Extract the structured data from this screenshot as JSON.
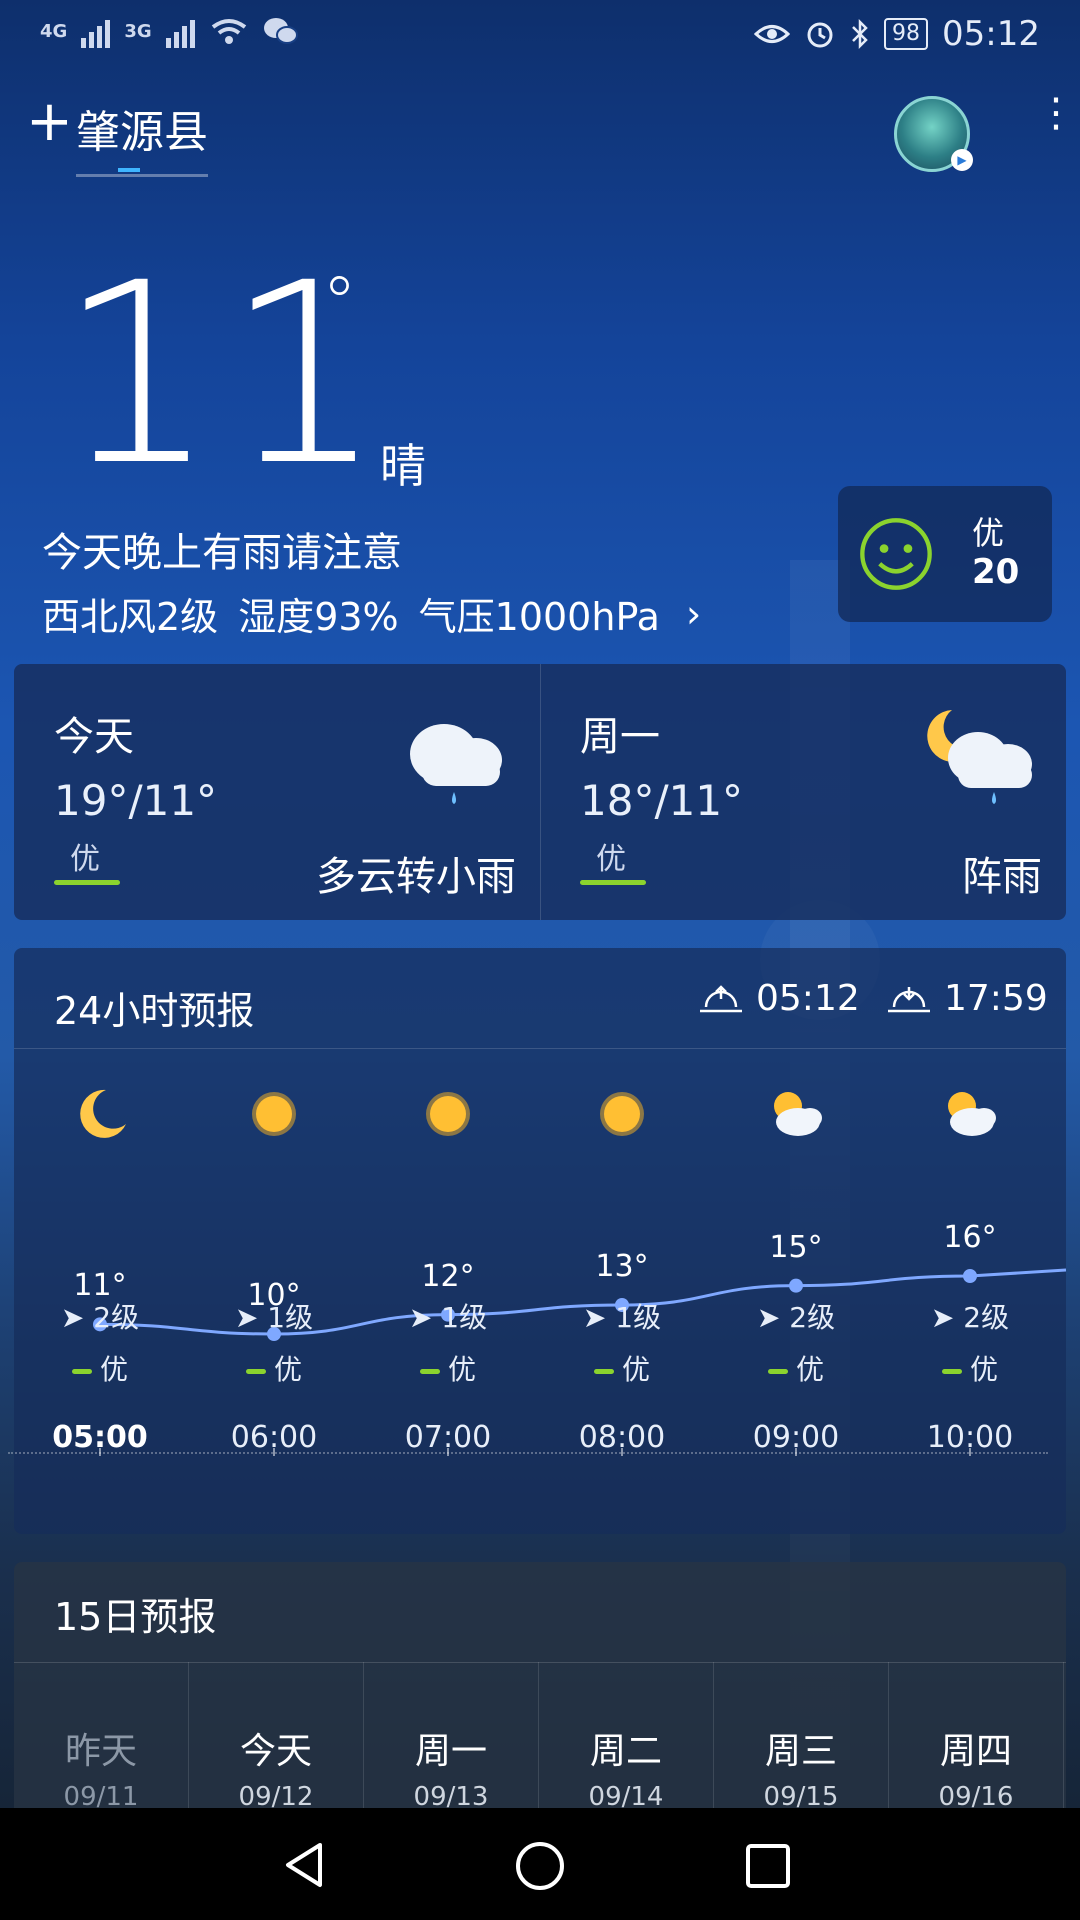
{
  "status_bar": {
    "net1": "4G",
    "net2": "3G",
    "battery": "98",
    "time": "05:12"
  },
  "header": {
    "add_icon": "plus-icon",
    "city": "肇源县",
    "more_icon": "more-vert-icon"
  },
  "current": {
    "temperature": "11",
    "degree": "°",
    "condition": "晴",
    "alert": "今天晚上有雨请注意",
    "wind": "西北风2级",
    "humidity": "湿度93%",
    "pressure": "气压1000hPa",
    "chevron": "›"
  },
  "aqi": {
    "label": "优",
    "value": "20",
    "color": "#8bd32e"
  },
  "days": [
    {
      "name": "今天",
      "temps": "19°/11°",
      "aqi": "优",
      "condition": "多云转小雨",
      "icon": "cloud-rain-icon"
    },
    {
      "name": "周一",
      "temps": "18°/11°",
      "aqi": "优",
      "condition": "阵雨",
      "icon": "moon-cloud-rain-icon"
    }
  ],
  "hourly": {
    "title": "24小时预报",
    "sunrise": "05:12",
    "sunset": "17:59",
    "hours": [
      {
        "time": "05:00",
        "temp": "11°",
        "value": 11,
        "wind": "2级",
        "aqi": "优",
        "icon": "moon"
      },
      {
        "time": "06:00",
        "temp": "10°",
        "value": 10,
        "wind": "1级",
        "aqi": "优",
        "icon": "sun"
      },
      {
        "time": "07:00",
        "temp": "12°",
        "value": 12,
        "wind": "1级",
        "aqi": "优",
        "icon": "sun"
      },
      {
        "time": "08:00",
        "temp": "13°",
        "value": 13,
        "wind": "1级",
        "aqi": "优",
        "icon": "sun"
      },
      {
        "time": "09:00",
        "temp": "15°",
        "value": 15,
        "wind": "2级",
        "aqi": "优",
        "icon": "sun-cloud"
      },
      {
        "time": "10:00",
        "temp": "16°",
        "value": 16,
        "wind": "2级",
        "aqi": "优",
        "icon": "sun-cloud"
      }
    ],
    "line_color": "#7fa8ff"
  },
  "days15": {
    "title": "15日预报",
    "items": [
      {
        "name": "昨天",
        "date": "09/11",
        "past": true
      },
      {
        "name": "今天",
        "date": "09/12",
        "past": false
      },
      {
        "name": "周一",
        "date": "09/13",
        "past": false
      },
      {
        "name": "周二",
        "date": "09/14",
        "past": false
      },
      {
        "name": "周三",
        "date": "09/15",
        "past": false
      },
      {
        "name": "周四",
        "date": "09/16",
        "past": false
      }
    ]
  }
}
